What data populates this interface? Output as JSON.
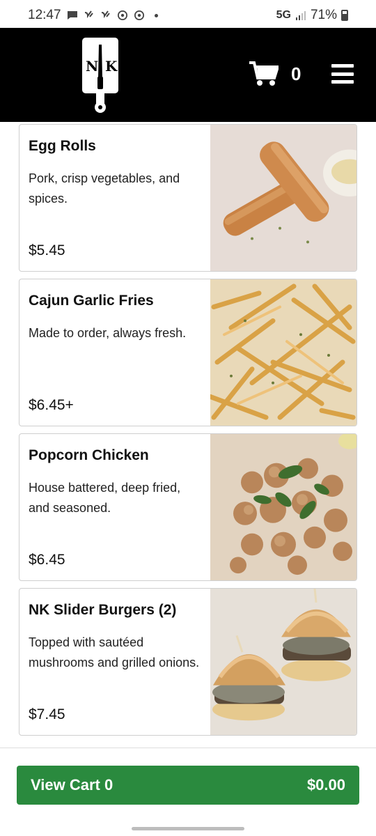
{
  "status_bar": {
    "time": "12:47",
    "network": "5G",
    "battery": "71%"
  },
  "header": {
    "logo_text": "NK",
    "cart_count": "0"
  },
  "menu_items": [
    {
      "name": "Egg Rolls",
      "description": "Pork, crisp vegetables, and spices.",
      "price": "$5.45"
    },
    {
      "name": "Cajun Garlic Fries",
      "description": "Made to order, always fresh.",
      "price": "$6.45+"
    },
    {
      "name": "Popcorn Chicken",
      "description": "House battered, deep fried, and seasoned.",
      "price": "$6.45"
    },
    {
      "name": "NK Slider Burgers (2)",
      "description": "Topped with sautéed mushrooms and grilled onions.",
      "price": "$7.45"
    }
  ],
  "footer": {
    "view_cart_label": "View Cart 0",
    "cart_total": "$0.00"
  },
  "colors": {
    "header_bg": "#000000",
    "accent_green": "#2a8a3e"
  }
}
